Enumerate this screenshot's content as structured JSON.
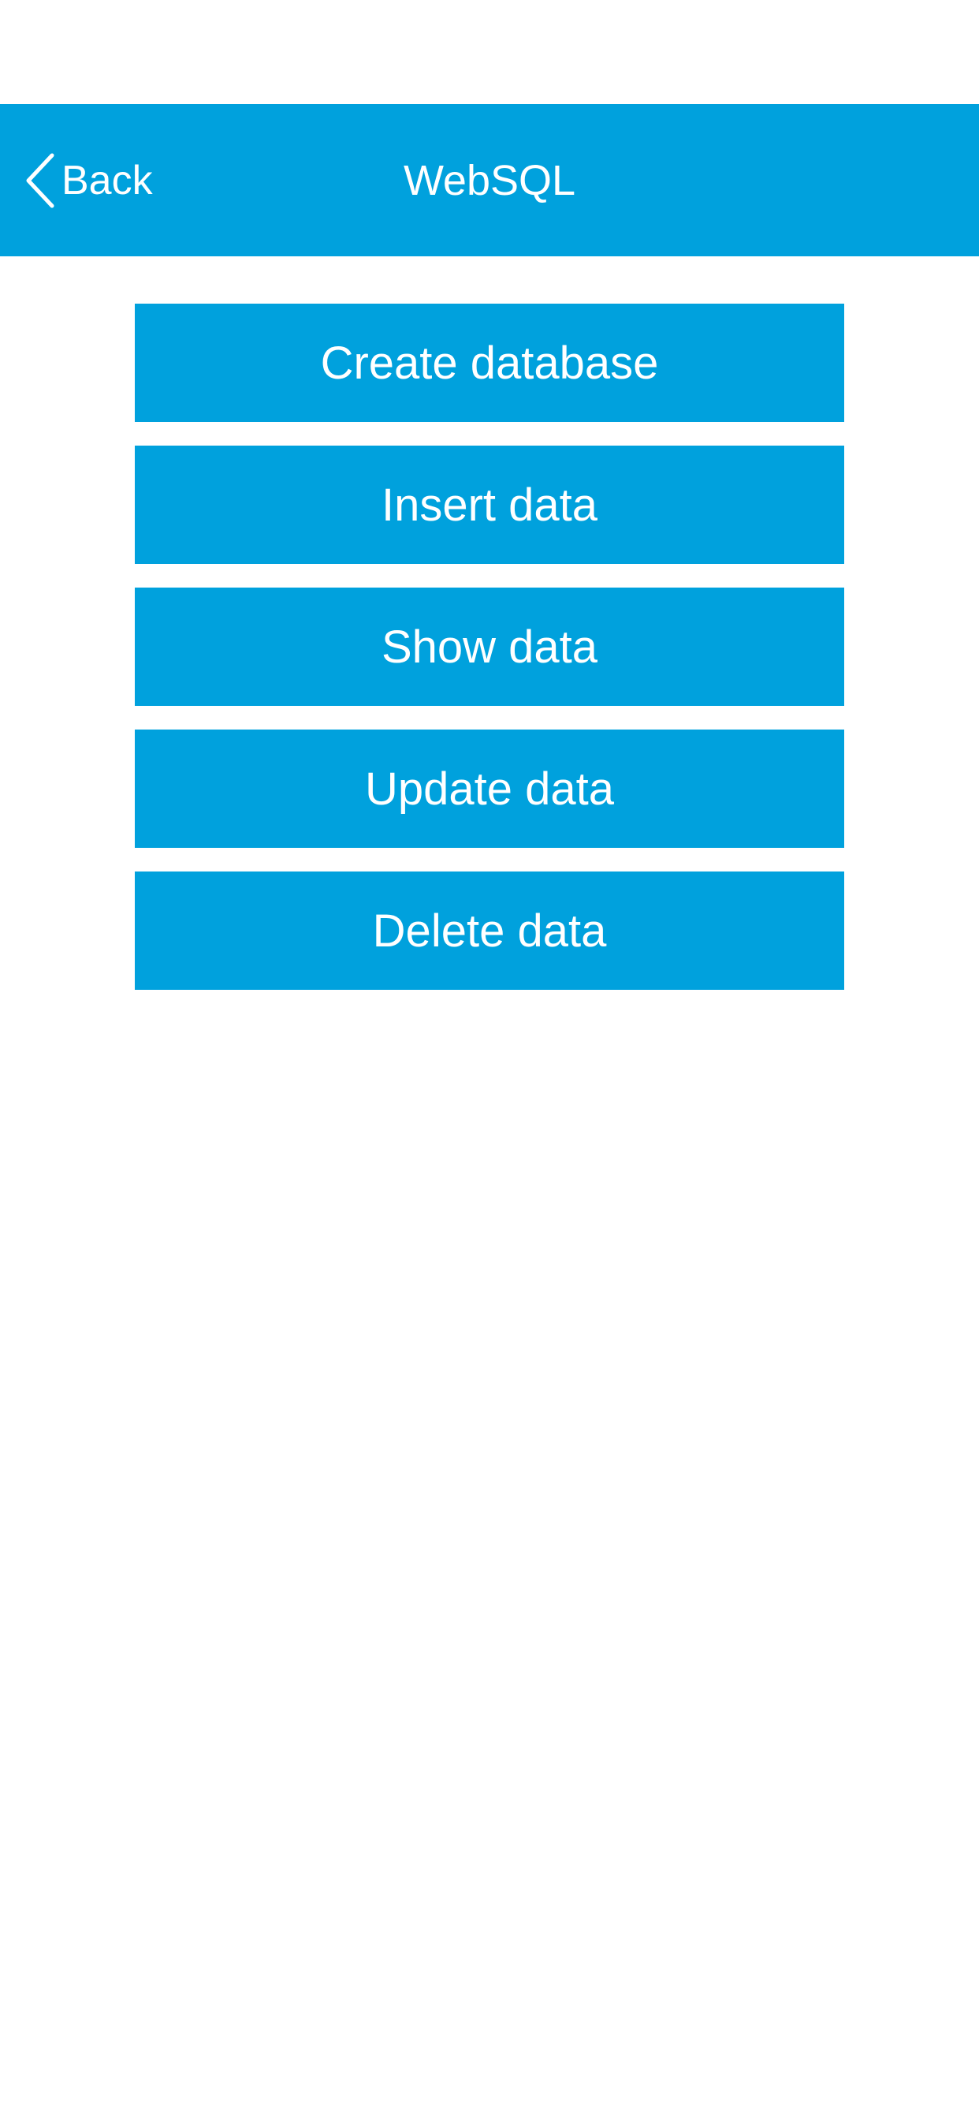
{
  "colors": {
    "accent": "#00a1dd",
    "text_on_accent": "#ffffff",
    "background": "#ffffff"
  },
  "nav": {
    "back_label": "Back",
    "back_icon": "chevron-left-icon",
    "title": "WebSQL"
  },
  "actions": [
    {
      "label": "Create database"
    },
    {
      "label": "Insert data"
    },
    {
      "label": "Show data"
    },
    {
      "label": "Update data"
    },
    {
      "label": "Delete data"
    }
  ]
}
